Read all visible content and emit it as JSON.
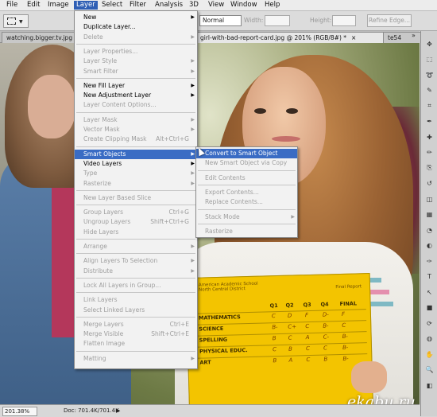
{
  "menubar": {
    "items": [
      "File",
      "Edit",
      "Image",
      "Layer",
      "Select",
      "Filter",
      "Analysis",
      "3D",
      "View",
      "Window",
      "Help"
    ],
    "active": "Layer"
  },
  "options": {
    "style_value": "Normal",
    "width_label": "Width:",
    "height_label": "Height:",
    "refine_label": "Refine Edge..."
  },
  "tabs": [
    {
      "label": "watching.bigger.tv.jpg",
      "active": false
    },
    {
      "label": "girl-with-bad-report-card.jpg @ 201% (RGB/8#) *",
      "active": true,
      "close": "×"
    },
    {
      "label": "te54",
      "active": false
    }
  ],
  "tab_overflow": "»",
  "layer_menu": {
    "items": [
      {
        "label": "New",
        "sub": true,
        "disabled": false
      },
      {
        "label": "Duplicate Layer...",
        "disabled": false
      },
      {
        "label": "Delete",
        "sub": true,
        "disabled": true
      },
      {
        "sep": true
      },
      {
        "label": "Layer Properties...",
        "disabled": true
      },
      {
        "label": "Layer Style",
        "sub": true,
        "disabled": true
      },
      {
        "label": "Smart Filter",
        "sub": true,
        "disabled": true
      },
      {
        "sep": true
      },
      {
        "label": "New Fill Layer",
        "sub": true,
        "disabled": false
      },
      {
        "label": "New Adjustment Layer",
        "sub": true,
        "disabled": false
      },
      {
        "label": "Layer Content Options...",
        "disabled": true
      },
      {
        "sep": true
      },
      {
        "label": "Layer Mask",
        "sub": true,
        "disabled": true
      },
      {
        "label": "Vector Mask",
        "sub": true,
        "disabled": true
      },
      {
        "label": "Create Clipping Mask",
        "shortcut": "Alt+Ctrl+G",
        "disabled": true
      },
      {
        "sep": true
      },
      {
        "label": "Smart Objects",
        "sub": true,
        "disabled": false,
        "highlighted": true
      },
      {
        "label": "Video Layers",
        "sub": true,
        "disabled": false
      },
      {
        "label": "Type",
        "sub": true,
        "disabled": true
      },
      {
        "label": "Rasterize",
        "sub": true,
        "disabled": true
      },
      {
        "sep": true
      },
      {
        "label": "New Layer Based Slice",
        "disabled": true
      },
      {
        "sep": true
      },
      {
        "label": "Group Layers",
        "shortcut": "Ctrl+G",
        "disabled": true
      },
      {
        "label": "Ungroup Layers",
        "shortcut": "Shift+Ctrl+G",
        "disabled": true
      },
      {
        "label": "Hide Layers",
        "disabled": true
      },
      {
        "sep": true
      },
      {
        "label": "Arrange",
        "sub": true,
        "disabled": true
      },
      {
        "sep": true
      },
      {
        "label": "Align Layers To Selection",
        "sub": true,
        "disabled": true
      },
      {
        "label": "Distribute",
        "sub": true,
        "disabled": true
      },
      {
        "sep": true
      },
      {
        "label": "Lock All Layers in Group...",
        "disabled": true
      },
      {
        "sep": true
      },
      {
        "label": "Link Layers",
        "disabled": true
      },
      {
        "label": "Select Linked Layers",
        "disabled": true
      },
      {
        "sep": true
      },
      {
        "label": "Merge Layers",
        "shortcut": "Ctrl+E",
        "disabled": true
      },
      {
        "label": "Merge Visible",
        "shortcut": "Shift+Ctrl+E",
        "disabled": true
      },
      {
        "label": "Flatten Image",
        "disabled": true
      },
      {
        "sep": true
      },
      {
        "label": "Matting",
        "sub": true,
        "disabled": true
      }
    ],
    "sub_arrow": "▶"
  },
  "smart_menu": {
    "items": [
      {
        "label": "Convert to Smart Object",
        "disabled": false,
        "highlighted": true
      },
      {
        "label": "New Smart Object via Copy",
        "disabled": true
      },
      {
        "sep": true
      },
      {
        "label": "Edit Contents",
        "disabled": true
      },
      {
        "sep": true
      },
      {
        "label": "Export Contents...",
        "disabled": true
      },
      {
        "label": "Replace Contents...",
        "disabled": true
      },
      {
        "sep": true
      },
      {
        "label": "Stack Mode",
        "sub": true,
        "disabled": true
      },
      {
        "sep": true
      },
      {
        "label": "Rasterize",
        "disabled": true
      }
    ]
  },
  "report_card": {
    "school": "American Academic School",
    "district": "North Central District",
    "period": "Final Report",
    "headers": [
      "Q1",
      "Q2",
      "Q3",
      "Q4",
      "FINAL"
    ],
    "rows": [
      {
        "subject": "MATHEMATICS",
        "grades": [
          "C",
          "D",
          "F",
          "D-",
          "F"
        ]
      },
      {
        "subject": "SCIENCE",
        "grades": [
          "B-",
          "C+",
          "C",
          "B-",
          "C"
        ]
      },
      {
        "subject": "SPELLING",
        "grades": [
          "B",
          "C",
          "A",
          "C-",
          "B-"
        ]
      },
      {
        "subject": "PHYSICAL EDUC.",
        "grades": [
          "C",
          "B",
          "C",
          "C",
          "B-"
        ]
      },
      {
        "subject": "ART",
        "grades": [
          "B",
          "A",
          "C",
          "B",
          "B-"
        ]
      }
    ]
  },
  "watermark": "ekabu.ru",
  "status": {
    "zoom": "201.38%",
    "doc": "Doc: 701.4K/701.4K",
    "arrow": "▶"
  },
  "tools": [
    "move-icon",
    "marquee-icon",
    "lasso-icon",
    "quick-select-icon",
    "crop-icon",
    "eyedropper-icon",
    "healing-icon",
    "brush-icon",
    "stamp-icon",
    "history-brush-icon",
    "eraser-icon",
    "gradient-icon",
    "blur-icon",
    "dodge-icon",
    "pen-icon",
    "type-icon",
    "path-select-icon",
    "shape-icon",
    "3d-rotate-icon",
    "3d-orbit-icon",
    "hand-icon",
    "zoom-icon",
    "color-swatch-icon"
  ]
}
